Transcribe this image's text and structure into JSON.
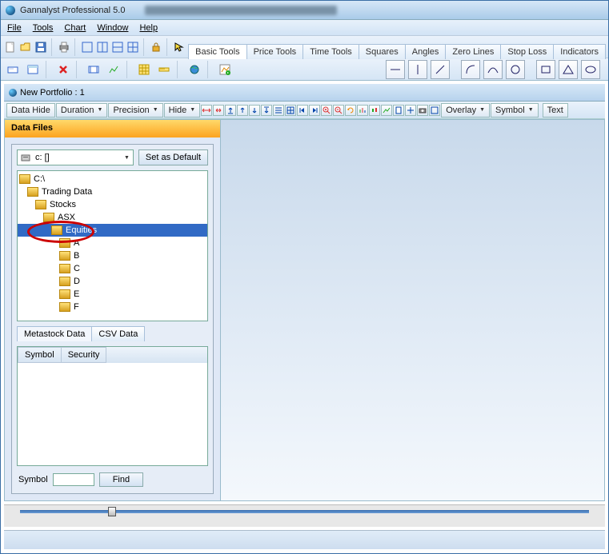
{
  "title": "Gannalyst Professional 5.0",
  "menubar": [
    "File",
    "Tools",
    "Chart",
    "Window",
    "Help"
  ],
  "tool_tabs": [
    "Basic Tools",
    "Price Tools",
    "Time Tools",
    "Squares",
    "Angles",
    "Zero Lines",
    "Stop Loss",
    "Indicators"
  ],
  "portfolio_title": "New Portfolio : 1",
  "inner_buttons": {
    "data_hide": "Data Hide",
    "duration": "Duration",
    "precision": "Precision",
    "hide": "Hide",
    "overlay": "Overlay",
    "symbol": "Symbol",
    "text": "Text"
  },
  "sidebar": {
    "header": "Data Files",
    "drive": "c: []",
    "default_btn": "Set as Default",
    "tree": [
      {
        "indent": 0,
        "label": "C:\\"
      },
      {
        "indent": 1,
        "label": "Trading Data"
      },
      {
        "indent": 2,
        "label": "Stocks"
      },
      {
        "indent": 3,
        "label": "ASX"
      },
      {
        "indent": 4,
        "label": "Equities",
        "selected": true
      },
      {
        "indent": 5,
        "label": "A"
      },
      {
        "indent": 5,
        "label": "B"
      },
      {
        "indent": 5,
        "label": "C"
      },
      {
        "indent": 5,
        "label": "D"
      },
      {
        "indent": 5,
        "label": "E"
      },
      {
        "indent": 5,
        "label": "F"
      }
    ],
    "data_tabs": [
      "Metastock Data",
      "CSV Data"
    ],
    "grid_cols": [
      "Symbol",
      "Security"
    ],
    "symbol_label": "Symbol",
    "find_label": "Find"
  }
}
